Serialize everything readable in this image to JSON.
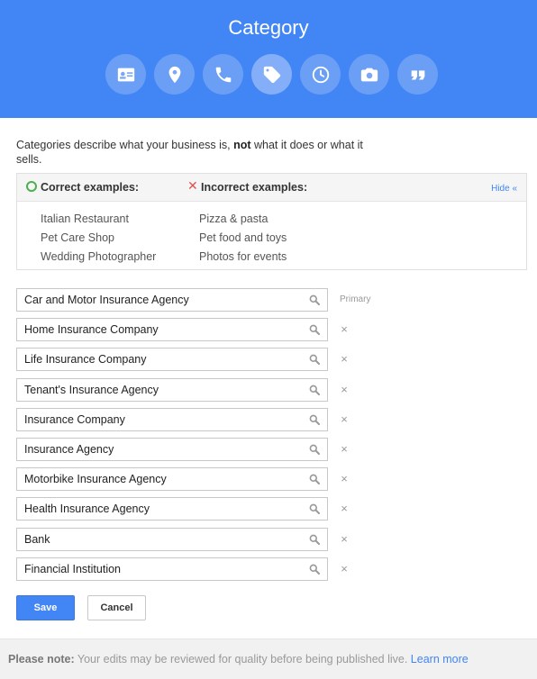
{
  "header": {
    "title": "Category",
    "tabs": [
      {
        "icon": "contact-card-icon"
      },
      {
        "icon": "location-pin-icon"
      },
      {
        "icon": "phone-icon"
      },
      {
        "icon": "tag-icon",
        "active": true
      },
      {
        "icon": "clock-icon"
      },
      {
        "icon": "camera-icon"
      },
      {
        "icon": "quote-icon"
      }
    ]
  },
  "intro": {
    "before": "Categories describe what your business is, ",
    "bold": "not",
    "after": " what it does or what it sells."
  },
  "examples": {
    "correct_title": "Correct examples:",
    "incorrect_title": "Incorrect examples:",
    "hide_label": "Hide «",
    "correct": [
      "Italian Restaurant",
      "Pet Care Shop",
      "Wedding Photographer"
    ],
    "incorrect": [
      "Pizza & pasta",
      "Pet food and toys",
      "Photos for events"
    ]
  },
  "categories": {
    "primary_label": "Primary",
    "remove_glyph": "×",
    "items": [
      "Car and Motor Insurance Agency",
      "Home Insurance Company",
      "Life Insurance Company",
      "Tenant's Insurance Agency",
      "Insurance Company",
      "Insurance Agency",
      "Motorbike Insurance Agency",
      "Health Insurance Agency",
      "Bank",
      "Financial Institution"
    ]
  },
  "actions": {
    "save_label": "Save",
    "cancel_label": "Cancel"
  },
  "footer": {
    "note_label": "Please note:",
    "note_text": " Your edits may be reviewed for quality before being published live. ",
    "learn_more": "Learn more"
  },
  "colors": {
    "brand_blue": "#4285f4",
    "correct_green": "#4caf50",
    "incorrect_red": "#d9534f"
  }
}
